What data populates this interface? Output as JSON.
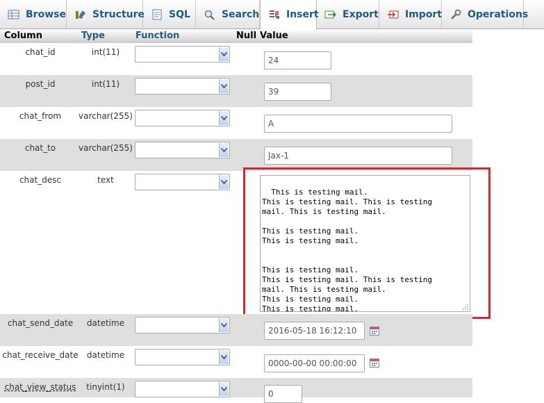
{
  "tabs": [
    {
      "label": "Browse",
      "icon": "browse-icon"
    },
    {
      "label": "Structure",
      "icon": "structure-icon"
    },
    {
      "label": "SQL",
      "icon": "sql-icon"
    },
    {
      "label": "Search",
      "icon": "search-icon"
    },
    {
      "label": "Insert",
      "icon": "insert-icon"
    },
    {
      "label": "Export",
      "icon": "export-icon"
    },
    {
      "label": "Import",
      "icon": "import-icon"
    },
    {
      "label": "Operations",
      "icon": "operations-icon"
    }
  ],
  "active_tab": "Insert",
  "header": {
    "column": "Column",
    "type": "Type",
    "function": "Function",
    "null": "Null",
    "value": "Value"
  },
  "rows": [
    {
      "name": "chat_id",
      "type": "int(11)",
      "value": "24"
    },
    {
      "name": "post_id",
      "type": "int(11)",
      "value": "39"
    },
    {
      "name": "chat_from",
      "type": "varchar(255)",
      "value": "A"
    },
    {
      "name": "chat_to",
      "type": "varchar(255)",
      "value": "Jax-1"
    },
    {
      "name": "chat_desc",
      "type": "text",
      "value": "This is testing mail.\nThis is testing mail. This is testing\nmail. This is testing mail.\n\nThis is testing mail.\nThis is testing mail.\n\n\nThis is testing mail.\nThis is testing mail. This is testing\nmail. This is testing mail.\nThis is testing mail.\nThis is testing mail."
    },
    {
      "name": "chat_send_date",
      "type": "datetime",
      "value": "2016-05-18 16:12:10"
    },
    {
      "name": "chat_receive_date",
      "type": "datetime",
      "value": "0000-00-00 00:00:00"
    },
    {
      "name": "chat_view_status",
      "type": "tinyint(1)",
      "value": "0"
    }
  ],
  "colors": {
    "tab_text": "#235a81",
    "highlight": "#d9262b",
    "row_alt": "#dfdfdf"
  }
}
